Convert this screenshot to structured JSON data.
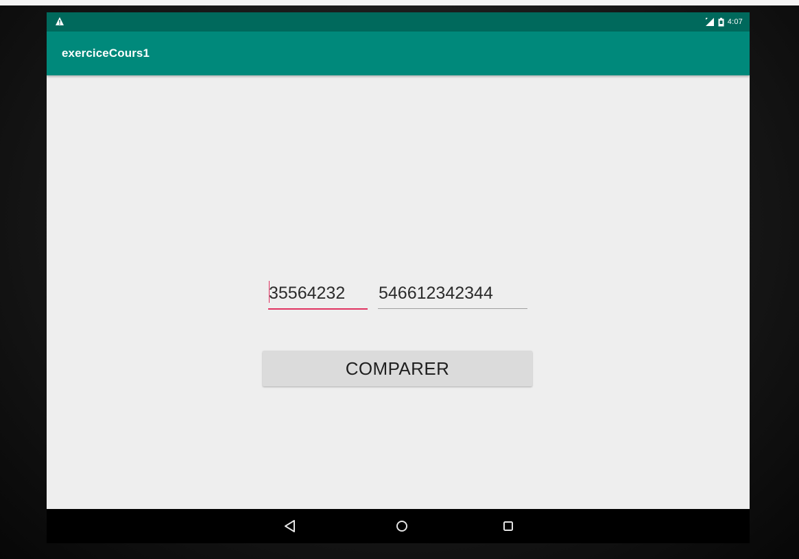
{
  "status_bar": {
    "time": "4:07",
    "icons": [
      "warning-icon",
      "signal-icon",
      "battery-icon"
    ]
  },
  "app_bar": {
    "title": "exerciceCours1"
  },
  "form": {
    "field_1": {
      "value": "35564232"
    },
    "field_2": {
      "value": "546612342344"
    },
    "compare_button_label": "COMPARER"
  },
  "nav_bar": {
    "icons": [
      "back-icon",
      "home-icon",
      "recents-icon"
    ]
  },
  "colors": {
    "status_bar": "#00695c",
    "app_bar": "#00897b",
    "accent": "#e0305f",
    "background": "#eeeeee",
    "button": "#dbdbdb"
  }
}
